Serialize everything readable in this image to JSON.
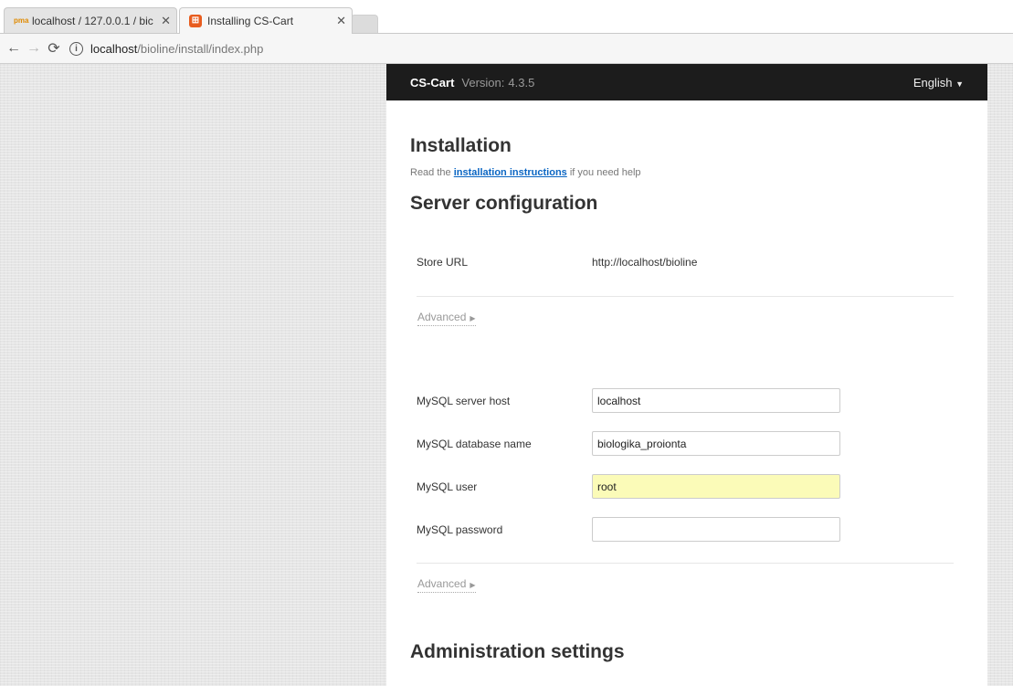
{
  "browser": {
    "tabs": [
      {
        "title": "localhost / 127.0.0.1 / bic",
        "active": false,
        "icon": "phpmyadmin-icon"
      },
      {
        "title": "Installing CS-Cart",
        "active": true,
        "icon": "cs-cart-icon"
      }
    ],
    "url": {
      "host": "localhost",
      "path": "/bioline/install/index.php"
    }
  },
  "header": {
    "brand": "CS-Cart",
    "version_label": "Version:",
    "version": "4.3.5",
    "language": "English"
  },
  "installation": {
    "title": "Installation",
    "help_prefix": "Read the",
    "help_link": "installation instructions",
    "help_suffix": "if you need help"
  },
  "server_config": {
    "title": "Server configuration",
    "store_url_label": "Store URL",
    "store_url_value": "http://localhost/bioline",
    "advanced_1": "Advanced",
    "db_host_label": "MySQL server host",
    "db_host_value": "localhost",
    "db_name_label": "MySQL database name",
    "db_name_value": "biologika_proionta",
    "db_user_label": "MySQL user",
    "db_user_value": "root",
    "db_password_label": "MySQL password",
    "db_password_value": "",
    "advanced_2": "Advanced"
  },
  "admin_settings": {
    "title": "Administration settings"
  },
  "colors": {
    "topbar": "#1c1c1c",
    "link": "#0b66c3",
    "autofill": "#fbfbb8"
  }
}
